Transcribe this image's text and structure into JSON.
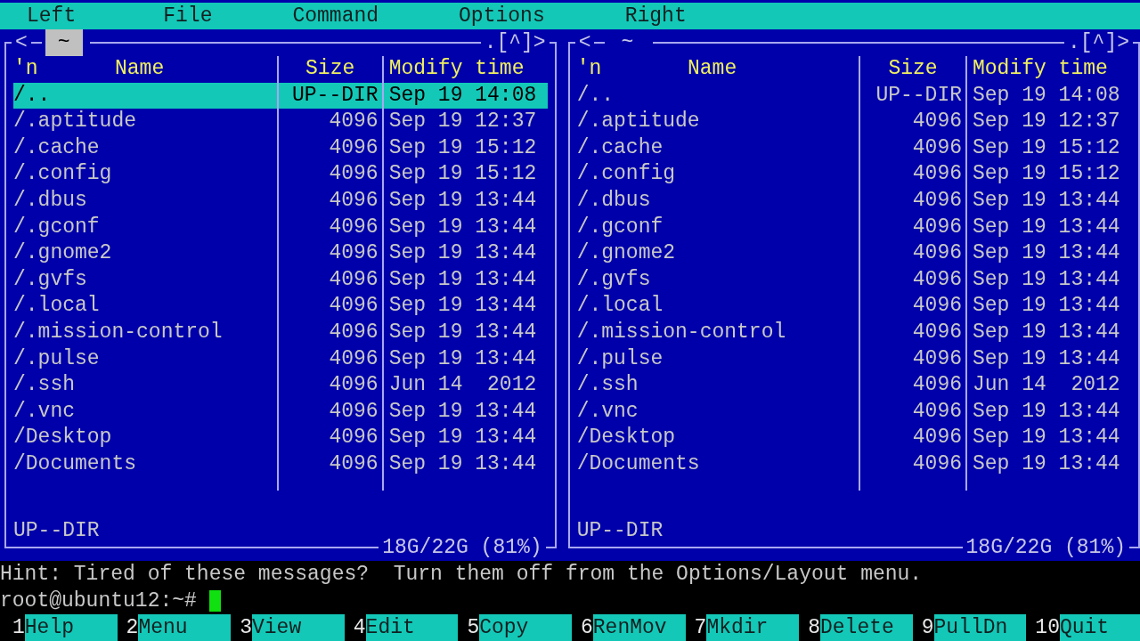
{
  "menu_bar": [
    {
      "label": "Left"
    },
    {
      "label": "File"
    },
    {
      "label": "Command"
    },
    {
      "label": "Options"
    },
    {
      "label": "Right"
    }
  ],
  "panels": [
    {
      "active": true,
      "left_mark": "<",
      "path": "~",
      "right_mark": ".[^]>",
      "columns": {
        "sort": "'n",
        "name": "Name",
        "size": "Size",
        "time": "Modify time"
      },
      "rows": [
        {
          "name": "/..",
          "size": "UP--DIR",
          "time": "Sep 19 14:08",
          "selected": true
        },
        {
          "name": "/.aptitude",
          "size": "4096",
          "time": "Sep 19 12:37",
          "selected": false
        },
        {
          "name": "/.cache",
          "size": "4096",
          "time": "Sep 19 15:12",
          "selected": false
        },
        {
          "name": "/.config",
          "size": "4096",
          "time": "Sep 19 15:12",
          "selected": false
        },
        {
          "name": "/.dbus",
          "size": "4096",
          "time": "Sep 19 13:44",
          "selected": false
        },
        {
          "name": "/.gconf",
          "size": "4096",
          "time": "Sep 19 13:44",
          "selected": false
        },
        {
          "name": "/.gnome2",
          "size": "4096",
          "time": "Sep 19 13:44",
          "selected": false
        },
        {
          "name": "/.gvfs",
          "size": "4096",
          "time": "Sep 19 13:44",
          "selected": false
        },
        {
          "name": "/.local",
          "size": "4096",
          "time": "Sep 19 13:44",
          "selected": false
        },
        {
          "name": "/.mission-control",
          "size": "4096",
          "time": "Sep 19 13:44",
          "selected": false
        },
        {
          "name": "/.pulse",
          "size": "4096",
          "time": "Sep 19 13:44",
          "selected": false
        },
        {
          "name": "/.ssh",
          "size": "4096",
          "time": "Jun 14  2012",
          "selected": false
        },
        {
          "name": "/.vnc",
          "size": "4096",
          "time": "Sep 19 13:44",
          "selected": false
        },
        {
          "name": "/Desktop",
          "size": "4096",
          "time": "Sep 19 13:44",
          "selected": false
        },
        {
          "name": "/Documents",
          "size": "4096",
          "time": "Sep 19 13:44",
          "selected": false
        }
      ],
      "mini_status": "UP--DIR",
      "disk_usage": "18G/22G (81%)"
    },
    {
      "active": false,
      "left_mark": "<",
      "path": "~",
      "right_mark": ".[^]>",
      "columns": {
        "sort": "'n",
        "name": "Name",
        "size": "Size",
        "time": "Modify time"
      },
      "rows": [
        {
          "name": "/..",
          "size": "UP--DIR",
          "time": "Sep 19 14:08",
          "selected": false
        },
        {
          "name": "/.aptitude",
          "size": "4096",
          "time": "Sep 19 12:37",
          "selected": false
        },
        {
          "name": "/.cache",
          "size": "4096",
          "time": "Sep 19 15:12",
          "selected": false
        },
        {
          "name": "/.config",
          "size": "4096",
          "time": "Sep 19 15:12",
          "selected": false
        },
        {
          "name": "/.dbus",
          "size": "4096",
          "time": "Sep 19 13:44",
          "selected": false
        },
        {
          "name": "/.gconf",
          "size": "4096",
          "time": "Sep 19 13:44",
          "selected": false
        },
        {
          "name": "/.gnome2",
          "size": "4096",
          "time": "Sep 19 13:44",
          "selected": false
        },
        {
          "name": "/.gvfs",
          "size": "4096",
          "time": "Sep 19 13:44",
          "selected": false
        },
        {
          "name": "/.local",
          "size": "4096",
          "time": "Sep 19 13:44",
          "selected": false
        },
        {
          "name": "/.mission-control",
          "size": "4096",
          "time": "Sep 19 13:44",
          "selected": false
        },
        {
          "name": "/.pulse",
          "size": "4096",
          "time": "Sep 19 13:44",
          "selected": false
        },
        {
          "name": "/.ssh",
          "size": "4096",
          "time": "Jun 14  2012",
          "selected": false
        },
        {
          "name": "/.vnc",
          "size": "4096",
          "time": "Sep 19 13:44",
          "selected": false
        },
        {
          "name": "/Desktop",
          "size": "4096",
          "time": "Sep 19 13:44",
          "selected": false
        },
        {
          "name": "/Documents",
          "size": "4096",
          "time": "Sep 19 13:44",
          "selected": false
        }
      ],
      "mini_status": "UP--DIR",
      "disk_usage": "18G/22G (81%)"
    }
  ],
  "hint": "Hint: Tired of these messages?  Turn them off from the Options/Layout menu.",
  "prompt": "root@ubuntu12:~#",
  "function_keys": [
    {
      "number": "1",
      "label": "Help"
    },
    {
      "number": "2",
      "label": "Menu"
    },
    {
      "number": "3",
      "label": "View"
    },
    {
      "number": "4",
      "label": "Edit"
    },
    {
      "number": "5",
      "label": "Copy"
    },
    {
      "number": "6",
      "label": "RenMov"
    },
    {
      "number": "7",
      "label": "Mkdir"
    },
    {
      "number": "8",
      "label": "Delete"
    },
    {
      "number": "9",
      "label": "PullDn"
    },
    {
      "number": "10",
      "label": "Quit"
    }
  ]
}
